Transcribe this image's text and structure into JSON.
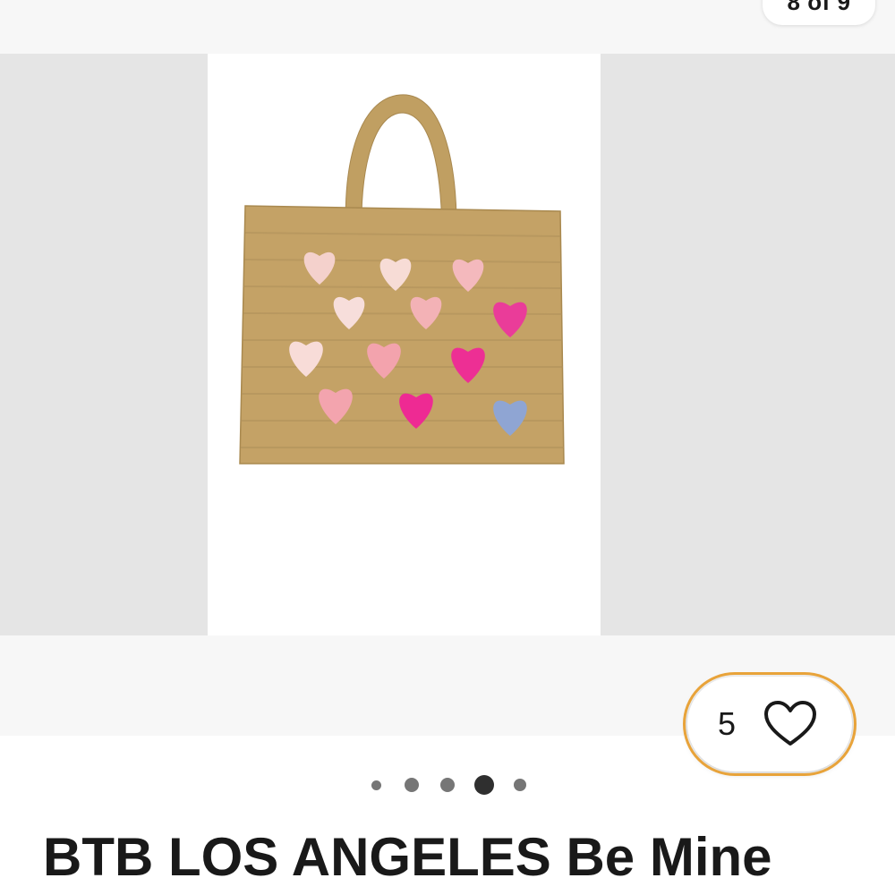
{
  "gallery": {
    "counter_text": "8 of 9",
    "main_image_alt": "BTB LOS ANGELES Be Mine straw tote with hearts",
    "total_dots": 5,
    "active_dot": 3
  },
  "watch": {
    "count": "5",
    "icon": "heart-outline-icon",
    "highlight_color": "#e8a33a"
  },
  "listing": {
    "title": "BTB LOS ANGELES Be Mine"
  },
  "colors": {
    "straw": "#c2a062",
    "heart_pale": "#f6d4d2",
    "heart_light_pink": "#f3a9b4",
    "heart_hot_pink": "#ee2a93",
    "heart_blue": "#8fa7d6"
  }
}
